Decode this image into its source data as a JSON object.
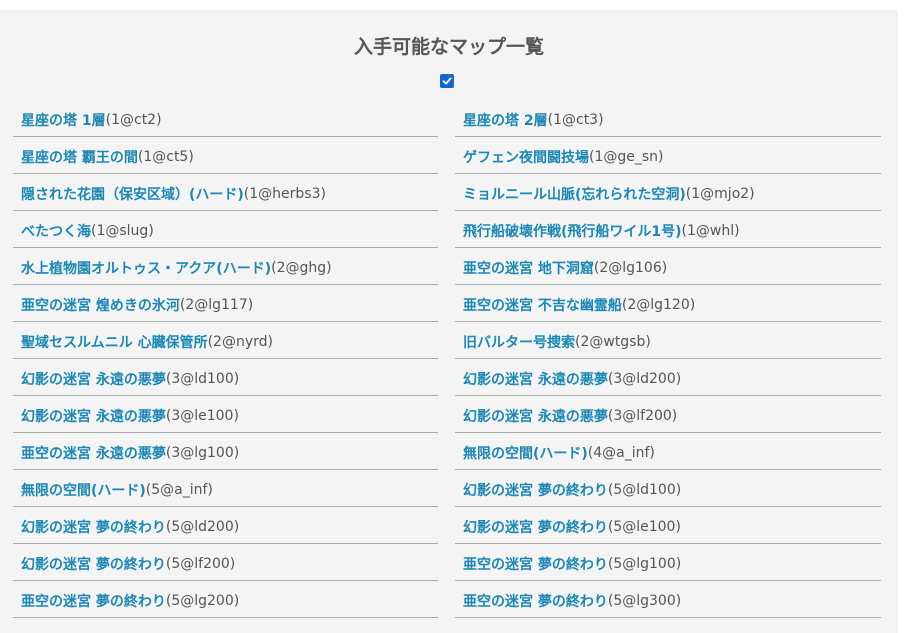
{
  "title": "入手可能なマップ一覧",
  "colors": {
    "link": "#1a87b5",
    "code": "#555555",
    "highlight": "#a8dcf3",
    "checkbox": "#1765d1"
  },
  "checkbox": {
    "checked": true,
    "icon": "checkmark-icon"
  },
  "left_column": [
    {
      "name": "星座の塔 1層",
      "code": "(1@ct2)"
    },
    {
      "name": "星座の塔 覇王の間",
      "code": "(1@ct5)"
    },
    {
      "name": "隠された花園（保安区域）(ハード)",
      "code": "(1@herbs3)"
    },
    {
      "name": "べたつく海",
      "code": "(1@slug)"
    },
    {
      "name": "水上植物園オルトゥス・アクア(ハード)",
      "code": "(2@ghg)"
    },
    {
      "name": "亜空の迷宮 煌めきの氷河",
      "code": "(2@lg117)"
    },
    {
      "name": "聖域セスルムニル 心臓保管所",
      "code": "(2@nyrd)"
    },
    {
      "name": "幻影の迷宮 永遠の悪夢",
      "code": "(3@ld100)"
    },
    {
      "name": "幻影の迷宮 永遠の悪夢",
      "code": "(3@le100)"
    },
    {
      "name": "亜空の迷宮 永遠の悪夢",
      "code": "(3@lg100)"
    },
    {
      "name": "無限の空間(ハード)",
      "code": "(5@a_inf)"
    },
    {
      "name": "幻影の迷宮 夢の終わり",
      "code": "(5@ld200)"
    },
    {
      "name": "幻影の迷宮 夢の終わり",
      "code": "(5@lf200)"
    },
    {
      "name": "亜空の迷宮 夢の終わり",
      "code": "(5@lg200)"
    }
  ],
  "right_column": [
    {
      "name": "星座の塔 2層",
      "code": "(1@ct3)"
    },
    {
      "name": "ゲフェン夜間闘技場",
      "code": "(1@ge_sn)"
    },
    {
      "name": "ミョルニール山脈(忘れられた空洞)",
      "code": "(1@mjo2)"
    },
    {
      "name": "飛行船破壊作戦(飛行船ワイル1号)",
      "code": "(1@whl)"
    },
    {
      "name": "亜空の迷宮 地下洞窟",
      "code": "(2@lg106)"
    },
    {
      "name": "亜空の迷宮 不吉な幽霊船",
      "code": "(2@lg120)"
    },
    {
      "name": "旧バルター号捜索",
      "code": "(2@wtgsb)"
    },
    {
      "name": "幻影の迷宮 永遠の悪夢",
      "code": "(3@ld200)"
    },
    {
      "name": "幻影の迷宮 永遠の悪夢",
      "code": "(3@lf200)"
    },
    {
      "name": "無限の空間(ハード)",
      "code": "(4@a_inf)"
    },
    {
      "name": "幻影の迷宮 夢の終わり",
      "code": "(5@ld100)"
    },
    {
      "name": "幻影の迷宮 夢の終わり",
      "code": "(5@le100)"
    },
    {
      "name": "亜空の迷宮 夢の終わり",
      "code": "(5@lg100)"
    },
    {
      "name": "亜空の迷宮 夢の終わり",
      "code": "(5@lg300)"
    }
  ]
}
